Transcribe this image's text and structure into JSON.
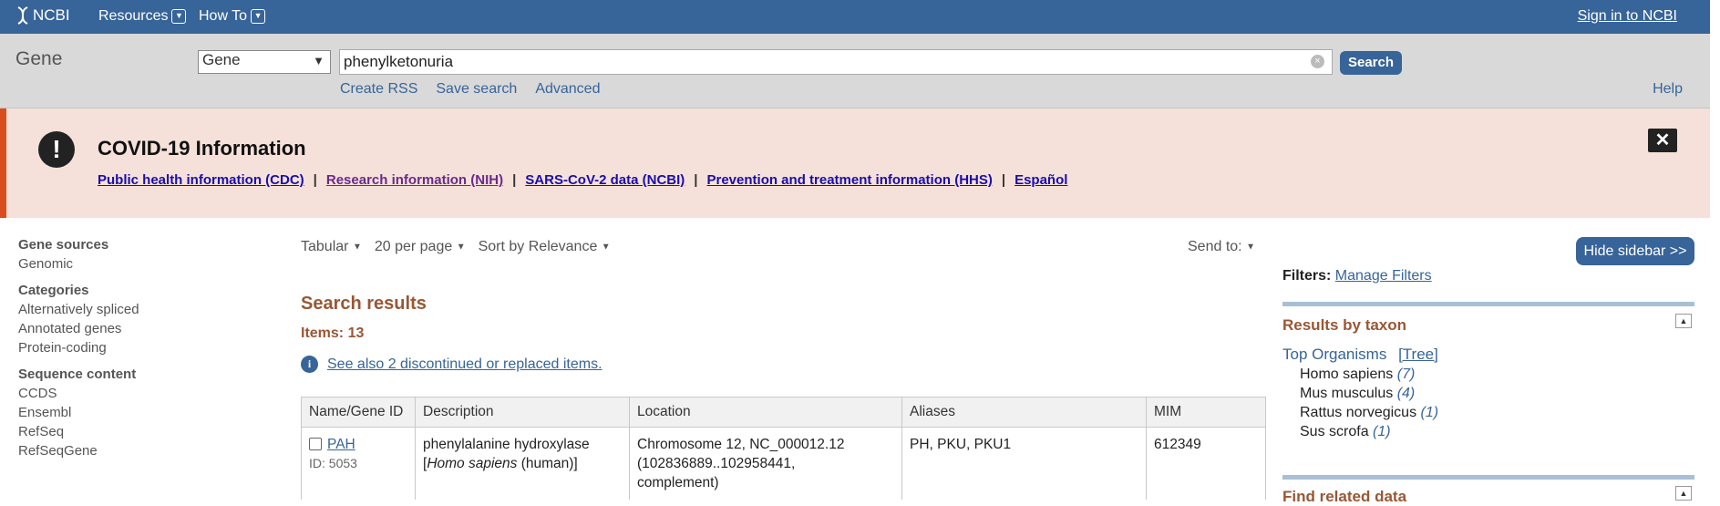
{
  "topbar": {
    "logo_text": "NCBI",
    "menu": [
      {
        "label": "Resources"
      },
      {
        "label": "How To"
      }
    ],
    "signin": "Sign in to NCBI"
  },
  "search": {
    "db_title": "Gene",
    "db_selected": "Gene",
    "term": "phenylketonuria",
    "button": "Search",
    "links": [
      "Create RSS",
      "Save search",
      "Advanced"
    ],
    "help": "Help"
  },
  "covid": {
    "title": "COVID-19 Information",
    "links": [
      "Public health information (CDC)",
      "Research information (NIH)",
      "SARS-CoV-2 data (NCBI)",
      "Prevention and treatment information (HHS)",
      "Español"
    ],
    "separator": "|"
  },
  "left_filters": [
    {
      "heading": "Gene sources",
      "items": [
        "Genomic"
      ]
    },
    {
      "heading": "Categories",
      "items": [
        "Alternatively spliced",
        "Annotated genes",
        "Protein-coding"
      ]
    },
    {
      "heading": "Sequence content",
      "items": [
        "CCDS",
        "Ensembl",
        "RefSeq",
        "RefSeqGene"
      ]
    }
  ],
  "controls": {
    "format": "Tabular",
    "per_page": "20 per page",
    "sort": "Sort by Relevance",
    "send_to": "Send to:"
  },
  "results": {
    "title": "Search results",
    "items": "Items: 13",
    "see_also": "See also 2 discontinued or replaced items.",
    "columns": [
      "Name/Gene ID",
      "Description",
      "Location",
      "Aliases",
      "MIM"
    ],
    "rows": [
      {
        "name": "PAH",
        "id": "ID: 5053",
        "desc_pre": "phenylalanine hydroxylase [",
        "desc_species": "Homo sapiens",
        "desc_post": " (human)]",
        "location_line1": "Chromosome 12, NC_000012.12",
        "location_line2": "(102836889..102958441,",
        "location_line3": "complement)",
        "aliases": "PH, PKU, PKU1",
        "mim": "612349"
      }
    ]
  },
  "sidebar": {
    "hide_button": "Hide sidebar >>",
    "filters_label": "Filters:",
    "manage_filters": "Manage Filters",
    "results_by_taxon": "Results by taxon",
    "top_organisms": "Top Organisms",
    "tree": "[Tree]",
    "organisms": [
      {
        "name": "Homo sapiens",
        "count": "(7)"
      },
      {
        "name": "Mus musculus",
        "count": "(4)"
      },
      {
        "name": "Rattus norvegicus",
        "count": "(1)"
      },
      {
        "name": "Sus scrofa",
        "count": "(1)"
      }
    ],
    "find_related": "Find related data"
  }
}
